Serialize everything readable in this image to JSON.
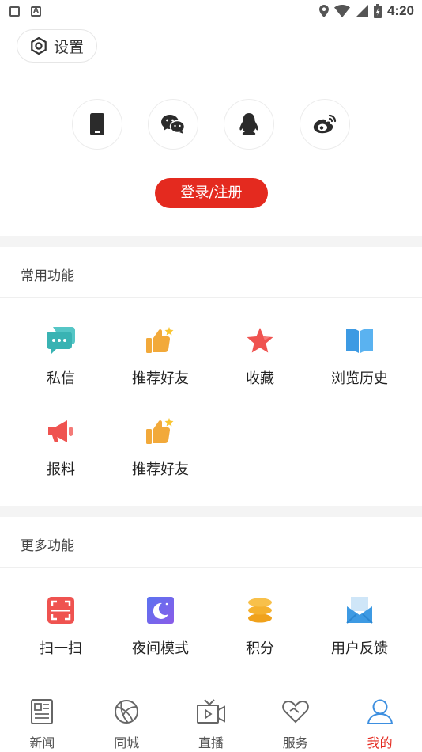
{
  "status_bar": {
    "time": "4:20"
  },
  "settings": {
    "label": "设置"
  },
  "login": {
    "methods": [
      "phone",
      "wechat",
      "qq",
      "weibo"
    ],
    "button_label": "登录/注册",
    "button_color": "#e42a1f"
  },
  "common_section": {
    "title": "常用功能",
    "items": [
      {
        "label": "私信",
        "icon": "message-icon"
      },
      {
        "label": "推荐好友",
        "icon": "thumbs-up-icon"
      },
      {
        "label": "收藏",
        "icon": "star-icon"
      },
      {
        "label": "浏览历史",
        "icon": "book-icon"
      },
      {
        "label": "报料",
        "icon": "megaphone-icon"
      },
      {
        "label": "推荐好友",
        "icon": "thumbs-up-icon"
      }
    ]
  },
  "more_section": {
    "title": "更多功能",
    "items": [
      {
        "label": "扫一扫",
        "icon": "scan-icon"
      },
      {
        "label": "夜间模式",
        "icon": "moon-icon"
      },
      {
        "label": "积分",
        "icon": "coins-icon"
      },
      {
        "label": "用户反馈",
        "icon": "mail-icon"
      }
    ]
  },
  "bottom_nav": {
    "active_color": "#e42a1f",
    "items": [
      {
        "label": "新闻",
        "icon": "news-icon"
      },
      {
        "label": "同城",
        "icon": "city-icon"
      },
      {
        "label": "直播",
        "icon": "tv-icon"
      },
      {
        "label": "服务",
        "icon": "heart-icon"
      },
      {
        "label": "我的",
        "icon": "user-icon",
        "active": true
      }
    ]
  }
}
